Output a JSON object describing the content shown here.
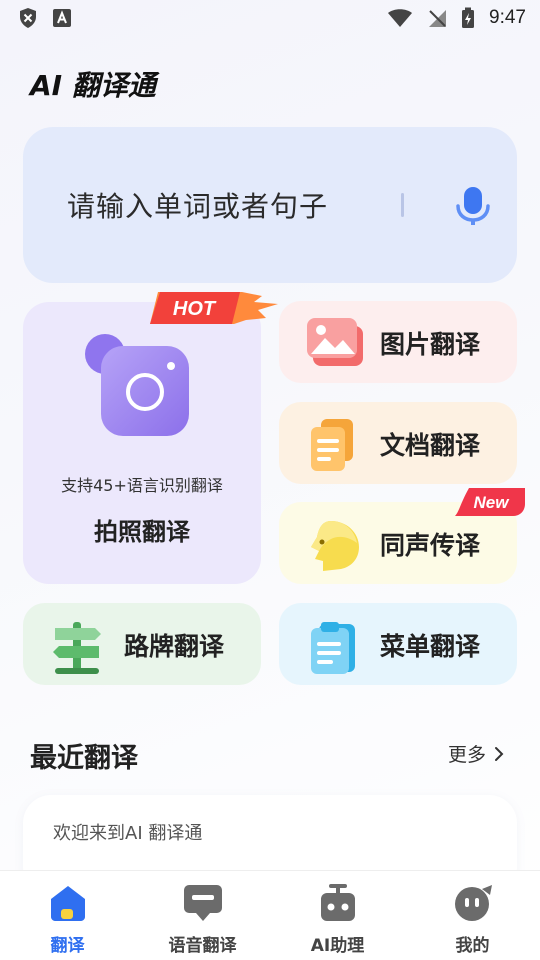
{
  "status_bar": {
    "time": "9:47"
  },
  "app": {
    "title": "AI 翻译通"
  },
  "search": {
    "placeholder": "请输入单词或者句子",
    "icon": "microphone-icon"
  },
  "photo_translate": {
    "badge": "HOT",
    "subtitle": "支持45+语言识别翻译",
    "title": "拍照翻译",
    "icon": "camera-icon"
  },
  "features": [
    {
      "label": "图片翻译",
      "icon": "image-icon"
    },
    {
      "label": "文档翻译",
      "icon": "document-icon"
    },
    {
      "label": "同声传译",
      "icon": "head-icon",
      "badge": "New"
    },
    {
      "label": "路牌翻译",
      "icon": "signpost-icon"
    },
    {
      "label": "菜单翻译",
      "icon": "clipboard-icon"
    }
  ],
  "recent": {
    "title": "最近翻译",
    "more_label": "更多",
    "items": [
      "欢迎来到AI 翻译通"
    ]
  },
  "tabs": [
    {
      "label": "翻译",
      "icon": "home-icon",
      "active": true
    },
    {
      "label": "语音翻译",
      "icon": "chat-icon",
      "active": false
    },
    {
      "label": "AI助理",
      "icon": "robot-icon",
      "active": false
    },
    {
      "label": "我的",
      "icon": "profile-icon",
      "active": false
    }
  ],
  "colors": {
    "accent": "#2f6ff0",
    "search_bg": "#e3eafb",
    "photo_card_bg": "#ece8fc",
    "hot_badge": "#f2413b",
    "new_badge": "#f0364a"
  }
}
